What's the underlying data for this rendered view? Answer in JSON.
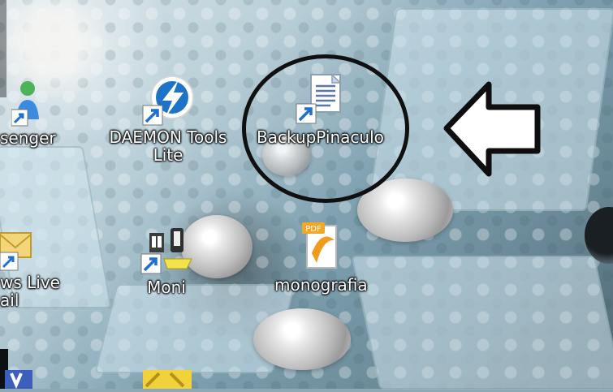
{
  "desktop": {
    "icons": [
      {
        "label": "senger"
      },
      {
        "label": "DAEMON Tools Lite"
      },
      {
        "label": "BackupPinaculo"
      },
      {
        "label": "ws Live ail"
      },
      {
        "label": "Moni"
      },
      {
        "label": "monografia"
      }
    ],
    "pdf_badge": "PDF"
  },
  "colors": {
    "annotation": "#101010",
    "label_text": "#ffffff",
    "shortcut_arrow": "#1f6fd1"
  },
  "icon_names": {
    "messenger": "messenger-icon",
    "daemon": "daemon-tools-icon",
    "backup": "document-shortcut-icon",
    "windows_live": "windows-live-mail-icon",
    "moni": "moni-icon",
    "pdf": "pdf-file-icon",
    "partial": "partial-program-icon"
  }
}
